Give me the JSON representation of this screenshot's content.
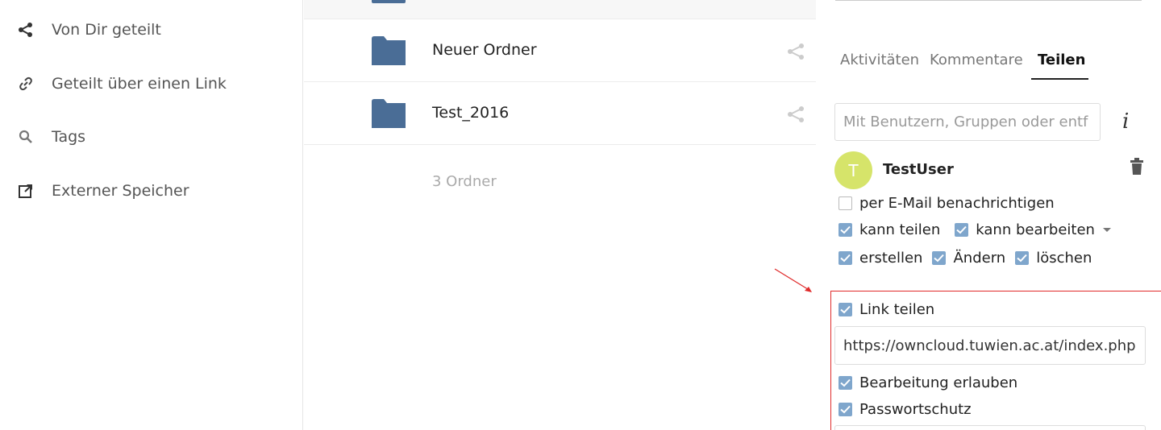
{
  "sidebar": {
    "items": [
      {
        "label": "Von Dir geteilt",
        "icon": "share-icon"
      },
      {
        "label": "Geteilt über einen Link",
        "icon": "link-icon"
      },
      {
        "label": "Tags",
        "icon": "search-icon"
      },
      {
        "label": "Externer Speicher",
        "icon": "external-link-icon"
      }
    ]
  },
  "files": {
    "rows": [
      {
        "name": "Neuer Ordner",
        "icon": "folder-icon",
        "action_icon": "share-icon"
      },
      {
        "name": "Test_2016",
        "icon": "folder-icon",
        "action_icon": "share-icon"
      }
    ],
    "summary": "3 Ordner"
  },
  "details": {
    "tabs": [
      {
        "label": "Aktivitäten",
        "active": false
      },
      {
        "label": "Kommentare",
        "active": false
      },
      {
        "label": "Teilen",
        "active": true
      }
    ],
    "share_input": {
      "placeholder": "Mit Benutzern, Gruppen oder entfernten Benutzern teilen …",
      "value": ""
    },
    "share_input_placeholder": "Mit Benutzern, Gruppen oder entf",
    "share": {
      "user": {
        "initial": "T",
        "name": "TestUser",
        "avatar_color": "#d6e46a"
      },
      "notify": {
        "label": "per E-Mail benachrichtigen",
        "checked": false
      },
      "can_share": {
        "label": "kann teilen",
        "checked": true
      },
      "can_edit": {
        "label": "kann bearbeiten",
        "checked": true
      },
      "create": {
        "label": "erstellen",
        "checked": true
      },
      "change": {
        "label": "Ändern",
        "checked": true
      },
      "delete": {
        "label": "löschen",
        "checked": true
      }
    },
    "link": {
      "share_link": {
        "label": "Link teilen",
        "checked": true
      },
      "url": "https://owncloud.tuwien.ac.at/index.php",
      "allow_edit": {
        "label": "Bearbeitung erlauben",
        "checked": true
      },
      "password": {
        "label": "Passwortschutz",
        "checked": true
      }
    }
  },
  "colors": {
    "folder": "#4a6d96",
    "checkbox": "#7fa6cc",
    "highlight": "#e02b2b"
  }
}
